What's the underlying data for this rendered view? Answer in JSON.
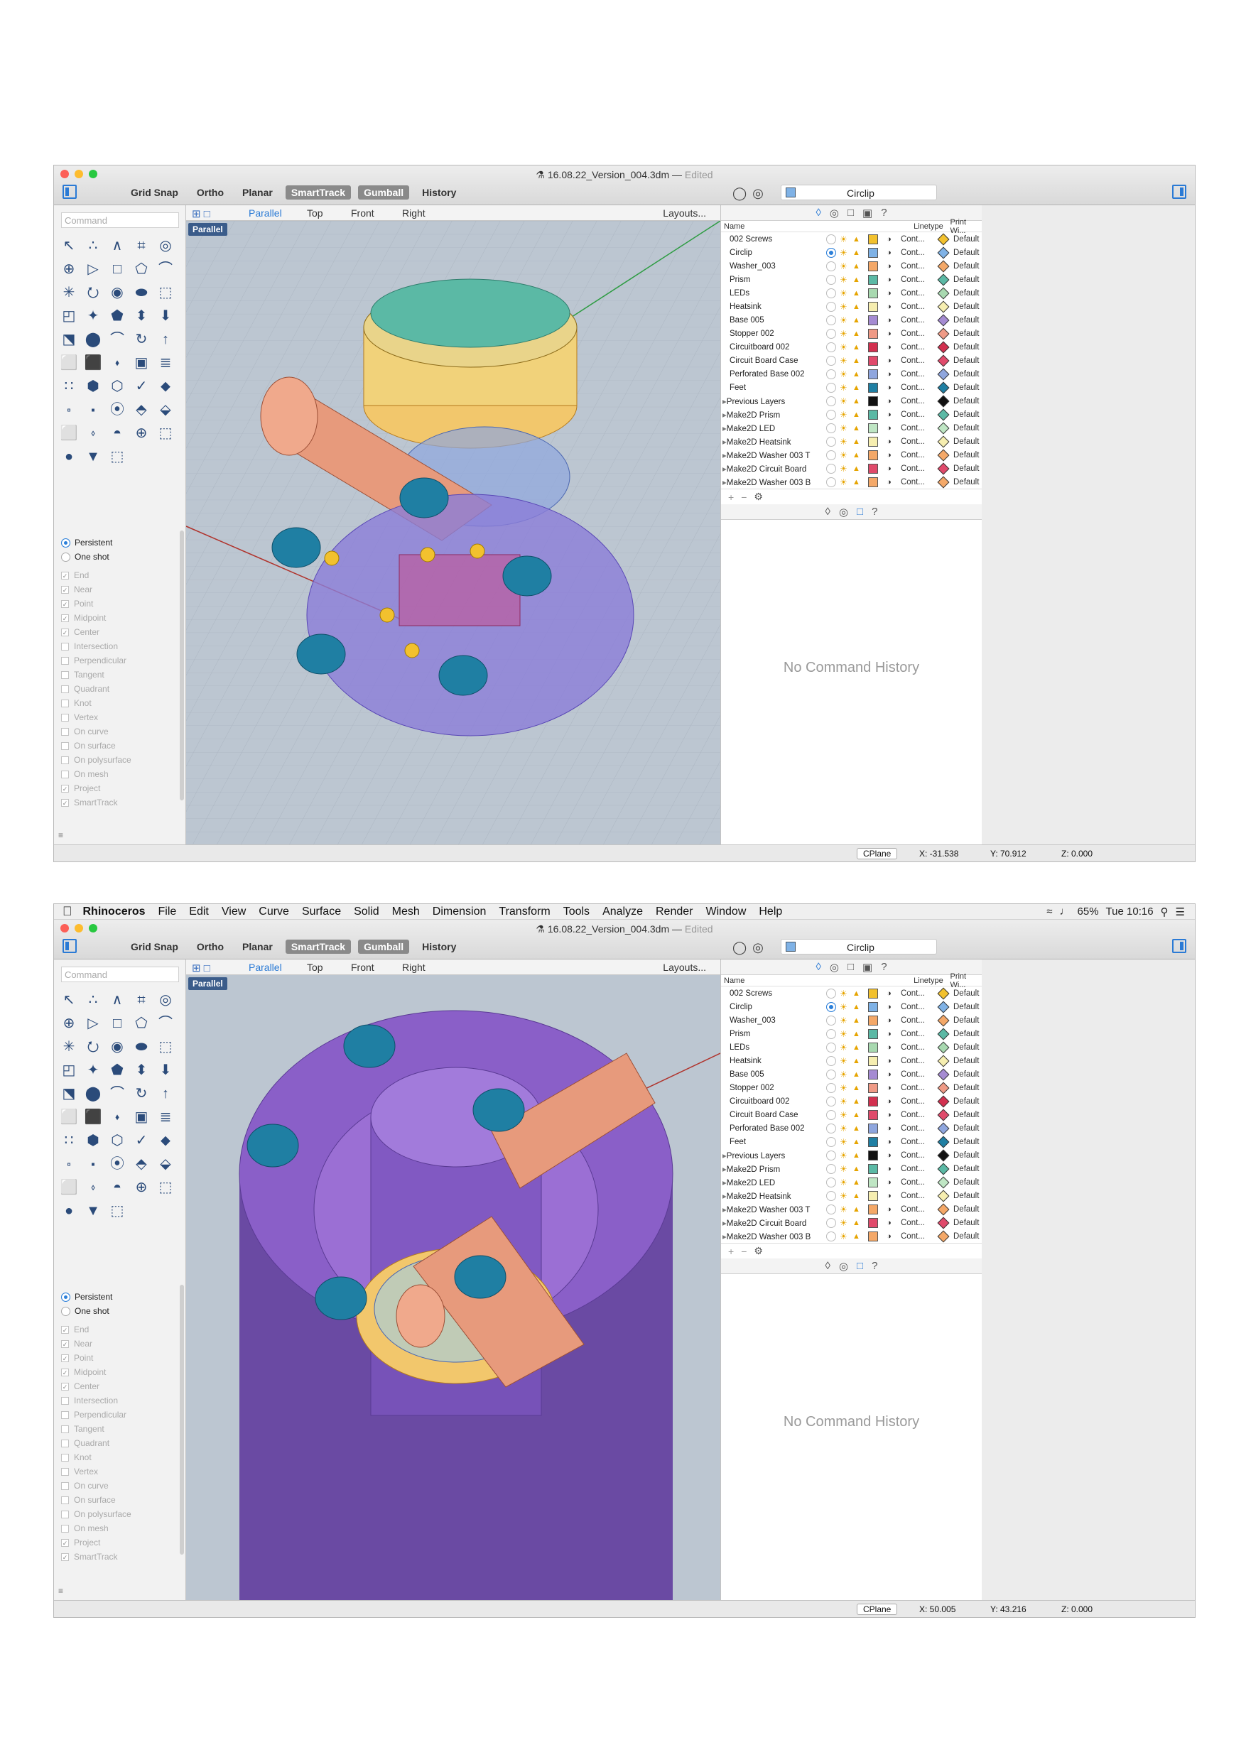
{
  "window": {
    "title": "16.08.22_Version_004.3dm",
    "edited": "Edited",
    "sep": "—"
  },
  "menubar": {
    "apple": "",
    "app": "Rhinoceros",
    "items": [
      "File",
      "Edit",
      "View",
      "Curve",
      "Surface",
      "Solid",
      "Mesh",
      "Dimension",
      "Transform",
      "Tools",
      "Analyze",
      "Render",
      "Window",
      "Help"
    ],
    "battery": "65%",
    "clock": "Tue 10:16"
  },
  "toolbar": {
    "toggles": [
      "Grid Snap",
      "Ortho",
      "Planar",
      "SmartTrack",
      "Gumball",
      "History"
    ],
    "active_toggles": [
      "SmartTrack",
      "Gumball"
    ],
    "current_layer": "Circlip"
  },
  "command": {
    "placeholder": "Command"
  },
  "viewport": {
    "tabs": [
      "Parallel",
      "Top",
      "Front",
      "Right"
    ],
    "layouts": "Layouts...",
    "label": "Parallel"
  },
  "osnap": {
    "persistent": "Persistent",
    "oneshot": "One shot",
    "items": [
      {
        "label": "End",
        "checked": true
      },
      {
        "label": "Near",
        "checked": true
      },
      {
        "label": "Point",
        "checked": true
      },
      {
        "label": "Midpoint",
        "checked": true
      },
      {
        "label": "Center",
        "checked": true
      },
      {
        "label": "Intersection",
        "checked": false
      },
      {
        "label": "Perpendicular",
        "checked": false
      },
      {
        "label": "Tangent",
        "checked": false
      },
      {
        "label": "Quadrant",
        "checked": false
      },
      {
        "label": "Knot",
        "checked": false
      },
      {
        "label": "Vertex",
        "checked": false
      },
      {
        "label": "On curve",
        "checked": false
      },
      {
        "label": "On surface",
        "checked": false
      },
      {
        "label": "On polysurface",
        "checked": false
      },
      {
        "label": "On mesh",
        "checked": false
      },
      {
        "label": "Project",
        "checked": true
      },
      {
        "label": "SmartTrack",
        "checked": true
      }
    ]
  },
  "layers": {
    "headers": {
      "name": "Name",
      "linetype": "Linetype",
      "print": "Print Wi..."
    },
    "linetype": "Cont...",
    "print": "Default",
    "rows": [
      {
        "name": "002 Screws",
        "color": "#f2c12e",
        "group": false,
        "current": false
      },
      {
        "name": "Circlip",
        "color": "#7fb2e6",
        "group": false,
        "current": true
      },
      {
        "name": "Washer_003",
        "color": "#f4a868",
        "group": false,
        "current": false
      },
      {
        "name": "Prism",
        "color": "#5bb9a5",
        "group": false,
        "current": false
      },
      {
        "name": "LEDs",
        "color": "#a8d9b0",
        "group": false,
        "current": false
      },
      {
        "name": "Heatsink",
        "color": "#f6eeb0",
        "group": false,
        "current": false
      },
      {
        "name": "Base 005",
        "color": "#a58bd2",
        "group": false,
        "current": false
      },
      {
        "name": "Stopper 002",
        "color": "#ef9a86",
        "group": false,
        "current": false
      },
      {
        "name": "Circuitboard 002",
        "color": "#d2304f",
        "group": false,
        "current": false
      },
      {
        "name": "Circuit Board Case",
        "color": "#e04a6b",
        "group": false,
        "current": false
      },
      {
        "name": "Perforated Base 002",
        "color": "#8fa6de",
        "group": false,
        "current": false
      },
      {
        "name": "Feet",
        "color": "#1f7fa3",
        "group": false,
        "current": false
      },
      {
        "name": "Previous Layers",
        "color": "#111111",
        "group": true,
        "current": false
      },
      {
        "name": "Make2D Prism",
        "color": "#5bb9a5",
        "group": true,
        "current": false
      },
      {
        "name": "Make2D LED",
        "color": "#bfe6c4",
        "group": true,
        "current": false
      },
      {
        "name": "Make2D Heatsink",
        "color": "#f6eeb0",
        "group": true,
        "current": false
      },
      {
        "name": "Make2D Washer 003 T",
        "color": "#f4a868",
        "group": true,
        "current": false
      },
      {
        "name": "Make2D Circuit Board",
        "color": "#e04a6b",
        "group": true,
        "current": false
      },
      {
        "name": "Make2D Washer 003 B",
        "color": "#f4a868",
        "group": true,
        "current": false
      }
    ]
  },
  "history": {
    "empty": "No Command History"
  },
  "status": {
    "cplane": "CPlane",
    "top": {
      "x": "X: -31.538",
      "y": "Y: 70.912",
      "z": "Z: 0.000"
    },
    "bottom": {
      "x": "X: 50.005",
      "y": "Y: 43.216",
      "z": "Z: 0.000"
    }
  },
  "colors": {
    "viewport_bg": "#bcc6d1",
    "accent": "#2a7ad5",
    "base_purple": "#8a5fc8",
    "copper": "#e79a7c",
    "feet_teal": "#1c6f8f"
  }
}
